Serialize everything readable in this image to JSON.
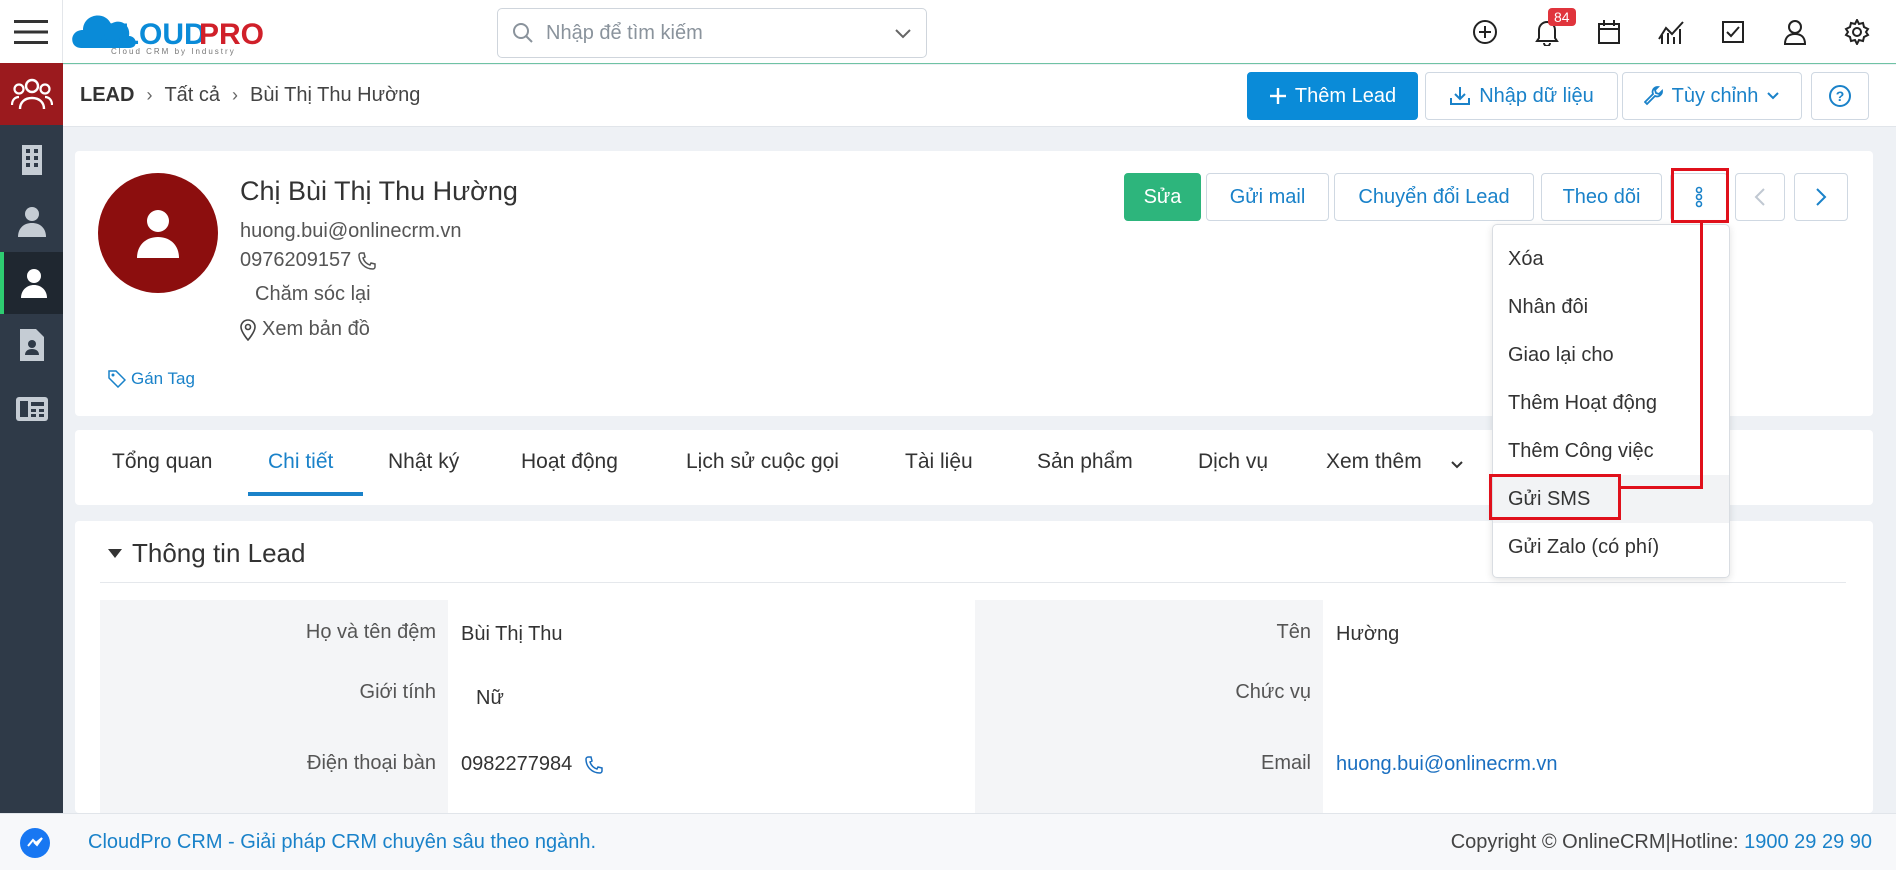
{
  "app": {
    "logo_text": "CLOUDPRO",
    "logo_tagline": "Cloud CRM by Industry"
  },
  "search": {
    "placeholder": "Nhập để tìm kiếm"
  },
  "notifications": {
    "count": "84"
  },
  "breadcrumb": {
    "module": "LEAD",
    "level1": "Tất cả",
    "current": "Bùi Thị Thu Hường"
  },
  "toolbar": {
    "add_lead": "Thêm Lead",
    "import": "Nhập dữ liệu",
    "customize": "Tùy chỉnh",
    "help": "?"
  },
  "record": {
    "name": "Chị Bùi Thị Thu Hường",
    "email": "huong.bui@onlinecrm.vn",
    "phone": "0976209157",
    "status": "Chăm sóc lại",
    "map": "Xem bản đồ",
    "tag": "Gán Tag"
  },
  "actions": {
    "edit": "Sửa",
    "send_mail": "Gửi mail",
    "convert": "Chuyển đổi Lead",
    "follow": "Theo dõi"
  },
  "more_menu": [
    "Xóa",
    "Nhân đôi",
    "Giao lại cho",
    "Thêm Hoạt động",
    "Thêm Công việc",
    "Gửi SMS",
    "Gửi Zalo (có phí)"
  ],
  "tabs": [
    "Tổng quan",
    "Chi tiết",
    "Nhật ký",
    "Hoạt động",
    "Lịch sử cuộc gọi",
    "Tài liệu",
    "Sản phẩm",
    "Dịch vụ",
    "Xem thêm"
  ],
  "active_tab": "Chi tiết",
  "section": {
    "title": "Thông tin Lead",
    "fields_left": [
      {
        "label": "Họ và tên đệm",
        "value": "Bùi Thị Thu"
      },
      {
        "label": "Giới tính",
        "value": "Nữ"
      },
      {
        "label": "Điện thoại bàn",
        "value": "0982277984"
      }
    ],
    "fields_right": [
      {
        "label": "Tên",
        "value": "Hường"
      },
      {
        "label": "Chức vụ",
        "value": ""
      },
      {
        "label": "Email",
        "value": "huong.bui@onlinecrm.vn"
      }
    ]
  },
  "footer": {
    "slogan": "CloudPro CRM - Giải pháp CRM chuyên sâu theo ngành.",
    "copyright": "Copyright © OnlineCRM|Hotline:",
    "hotline": "1900 29 29 90"
  },
  "colors": {
    "primary": "#0a8bd8",
    "success": "#2db57c",
    "sidebar": "#2f3a48",
    "highlight": "#e0101b",
    "avatar": "#8c0e0e"
  }
}
